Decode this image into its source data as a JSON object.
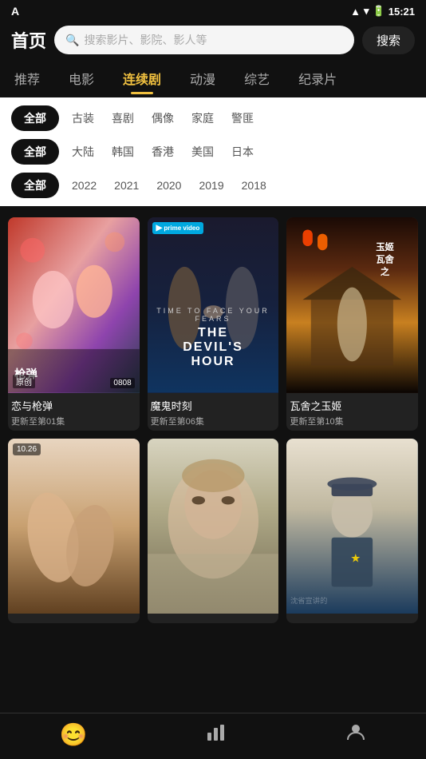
{
  "statusBar": {
    "carrier": "A",
    "time": "15:21",
    "signalFull": true,
    "wifi": true,
    "battery": "charging"
  },
  "header": {
    "title": "首页",
    "searchPlaceholder": "搜索影片、影院、影人等",
    "searchButtonLabel": "搜索"
  },
  "navTabs": [
    {
      "id": "recommend",
      "label": "推荐",
      "active": false
    },
    {
      "id": "movie",
      "label": "电影",
      "active": false
    },
    {
      "id": "series",
      "label": "连续剧",
      "active": true
    },
    {
      "id": "anime",
      "label": "动漫",
      "active": false
    },
    {
      "id": "variety",
      "label": "综艺",
      "active": false
    },
    {
      "id": "documentary",
      "label": "纪录片",
      "active": false
    }
  ],
  "filters": [
    {
      "id": "genre",
      "allLabel": "全部",
      "tags": [
        "古装",
        "喜剧",
        "偶像",
        "家庭",
        "警匪"
      ]
    },
    {
      "id": "region",
      "allLabel": "全部",
      "tags": [
        "大陆",
        "韩国",
        "香港",
        "美国",
        "日本"
      ]
    },
    {
      "id": "year",
      "allLabel": "全部",
      "tags": [
        "2022",
        "2021",
        "2020",
        "2019",
        "2018"
      ]
    }
  ],
  "cards": [
    {
      "id": "card-1",
      "title": "恋与枪弹",
      "subtitle": "更新至第01集",
      "poster": "poster-1",
      "badge": null
    },
    {
      "id": "card-2",
      "title": "魔鬼时刻",
      "subtitle": "更新至第06集",
      "poster": "poster-2",
      "badge": "prime video"
    },
    {
      "id": "card-3",
      "title": "瓦舍之玉姬",
      "subtitle": "更新至第10集",
      "poster": "poster-3",
      "badge": null
    },
    {
      "id": "card-4",
      "title": "",
      "subtitle": "",
      "poster": "poster-4",
      "badge": "10.26"
    },
    {
      "id": "card-5",
      "title": "",
      "subtitle": "",
      "poster": "poster-5",
      "badge": null
    },
    {
      "id": "card-6",
      "title": "",
      "subtitle": "",
      "poster": "poster-6",
      "badge": null
    }
  ],
  "bottomNav": [
    {
      "id": "home",
      "icon": "😊",
      "label": "",
      "active": true
    },
    {
      "id": "chart",
      "icon": "📊",
      "label": "",
      "active": false
    },
    {
      "id": "profile",
      "icon": "👤",
      "label": "",
      "active": false
    }
  ]
}
